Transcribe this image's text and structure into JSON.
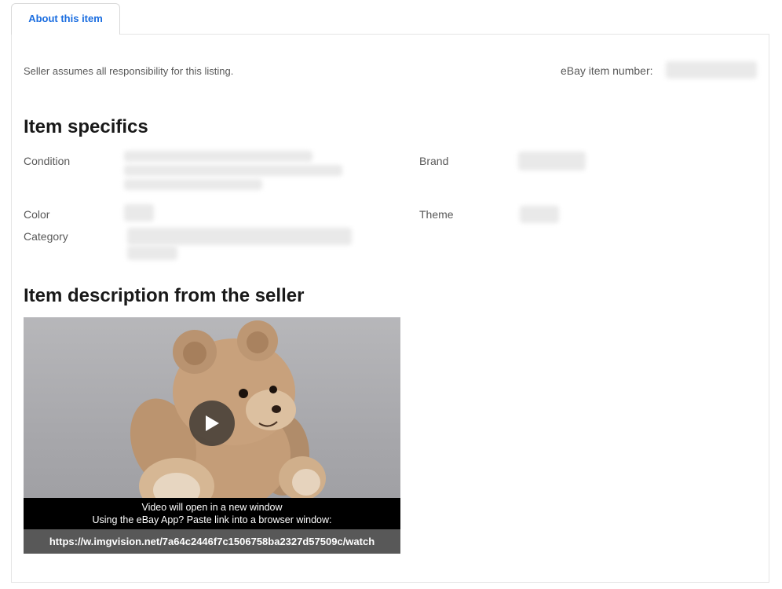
{
  "tabs": {
    "about_label": "About this item"
  },
  "header": {
    "responsibility": "Seller assumes all responsibility for this listing.",
    "item_number_label": "eBay item number:"
  },
  "specifics": {
    "title": "Item specifics",
    "condition_label": "Condition",
    "brand_label": "Brand",
    "color_label": "Color",
    "theme_label": "Theme",
    "category_label": "Category"
  },
  "description": {
    "title": "Item description from the seller"
  },
  "video": {
    "line1": "Video will open in a new window",
    "line2": "Using the eBay App? Paste link into a browser window:",
    "link": "https://w.imgvision.net/7a64c2446f7c1506758ba2327d57509c/watch"
  },
  "colors": {
    "tab_text": "#1a6de0",
    "heading": "#191919",
    "label": "#595959"
  }
}
